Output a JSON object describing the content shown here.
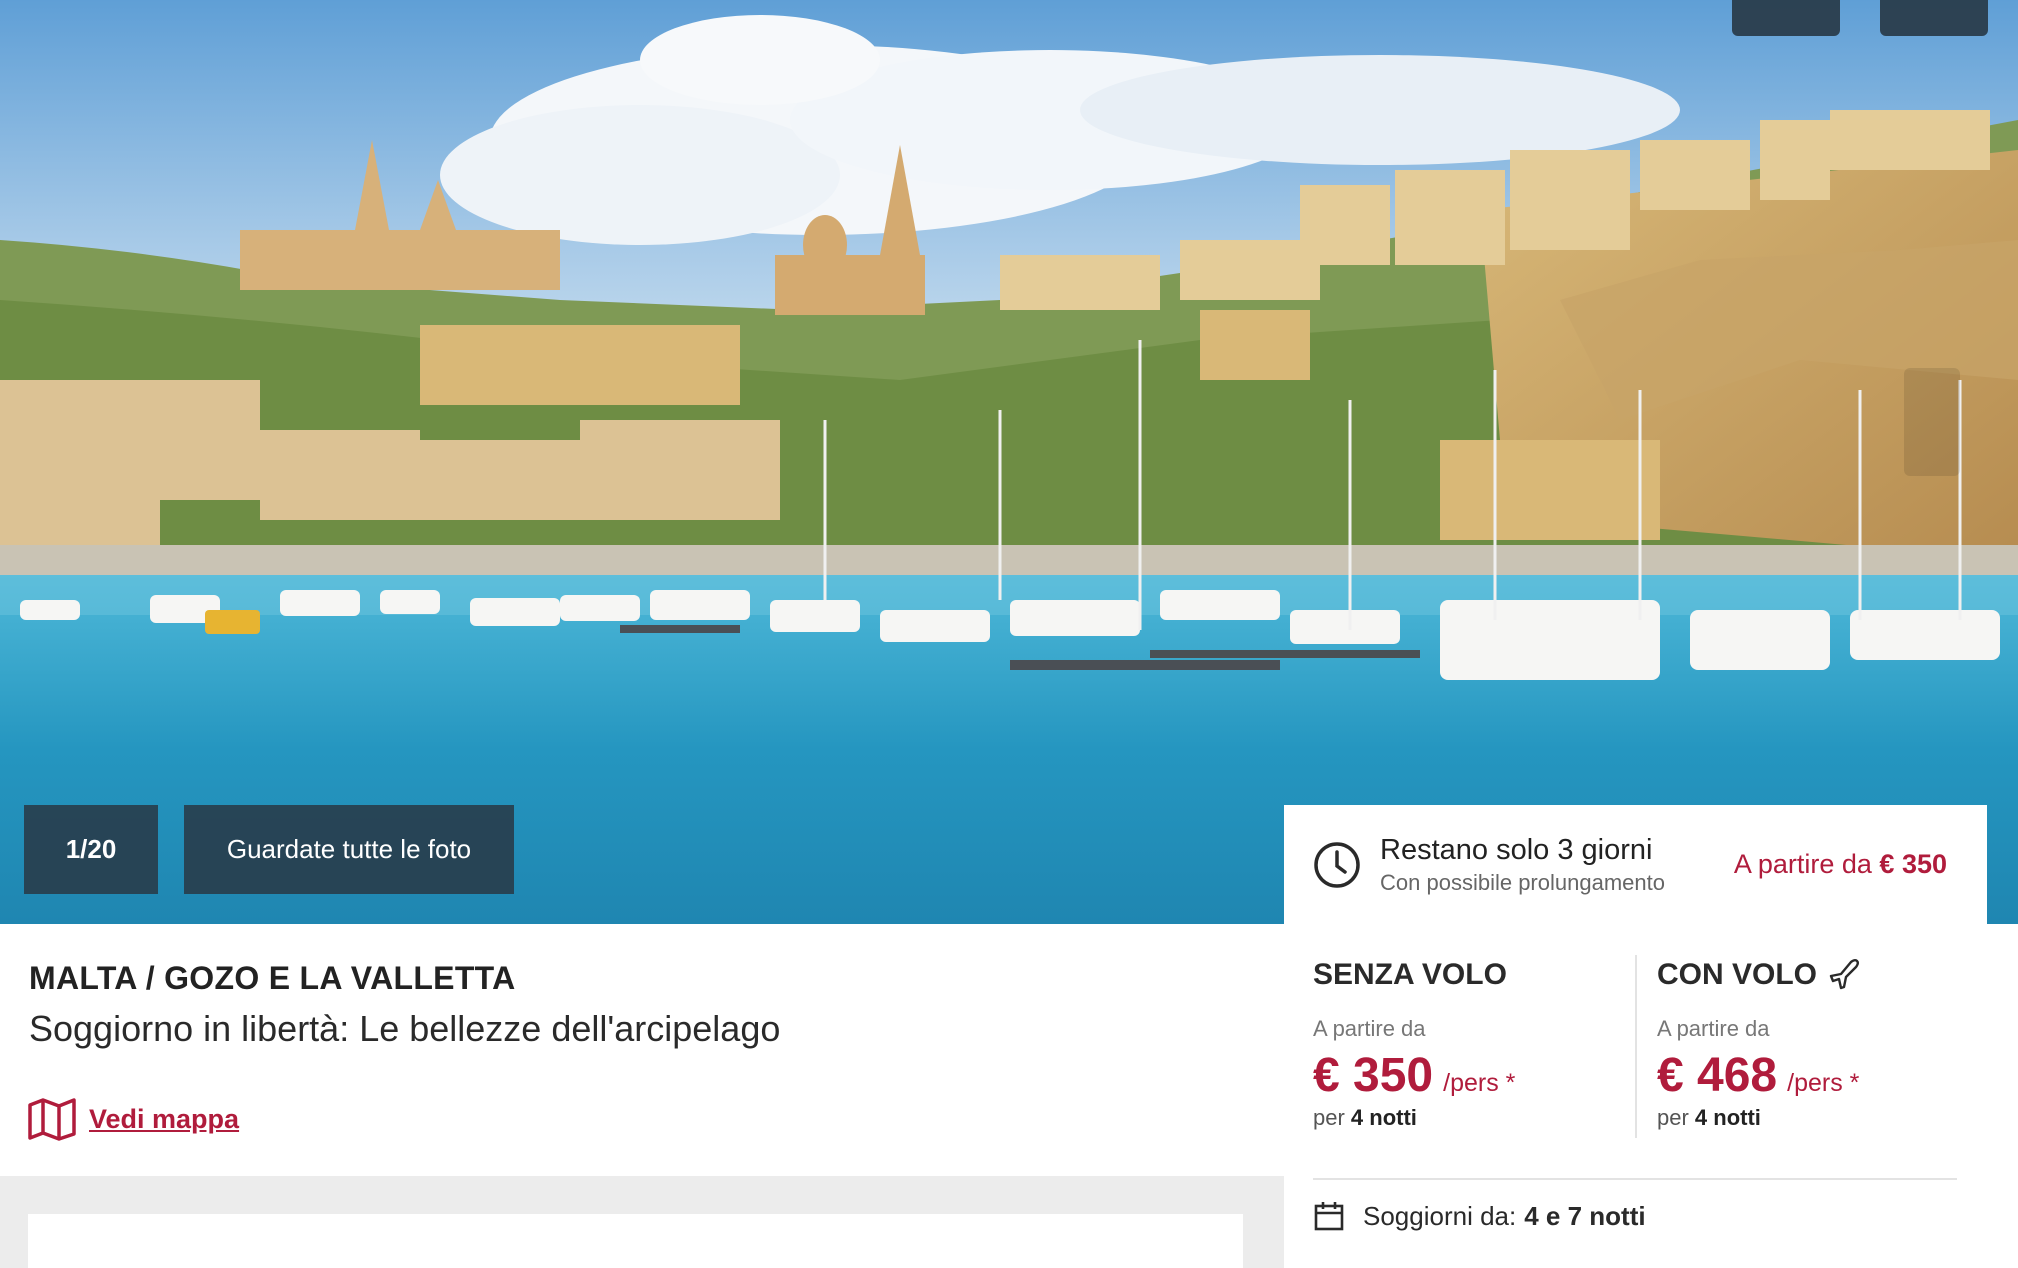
{
  "gallery": {
    "counter": "1/20",
    "all_photos_label": "Guardate tutte le foto"
  },
  "icons": {
    "top_left": "grid-icon",
    "top_right": "heart-icon",
    "next": "chevron-right-icon",
    "deadline": "clock-icon",
    "map": "map-icon",
    "flight": "plane-icon",
    "stays": "calendar-icon"
  },
  "deadline": {
    "title": "Restano solo 3 giorni",
    "subtitle": "Con possibile prolungamento",
    "price_prefix": "A partire da",
    "price": "€ 350"
  },
  "product": {
    "destination": "MALTA / GOZO E LA VALLETTA",
    "subtitle": "Soggiorno in libertà: Le bellezze dell'arcipelago",
    "map_link": "Vedi mappa"
  },
  "options": [
    {
      "title": "SENZA VOLO",
      "from_label": "A partire da",
      "price": "€ 350",
      "unit": "/pers *",
      "nights_prefix": "per",
      "nights": "4 notti"
    },
    {
      "title": "CON VOLO",
      "from_label": "A partire da",
      "price": "€ 468",
      "unit": "/pers *",
      "nights_prefix": "per",
      "nights": "4 notti"
    }
  ],
  "stays": {
    "label": "Soggiorni da:",
    "value": "4 e 7 notti"
  },
  "colors": {
    "accent": "#b01c3c",
    "overlay": "#283a48",
    "sea": "#2aa6c9",
    "sky": "#9cc4e4"
  }
}
